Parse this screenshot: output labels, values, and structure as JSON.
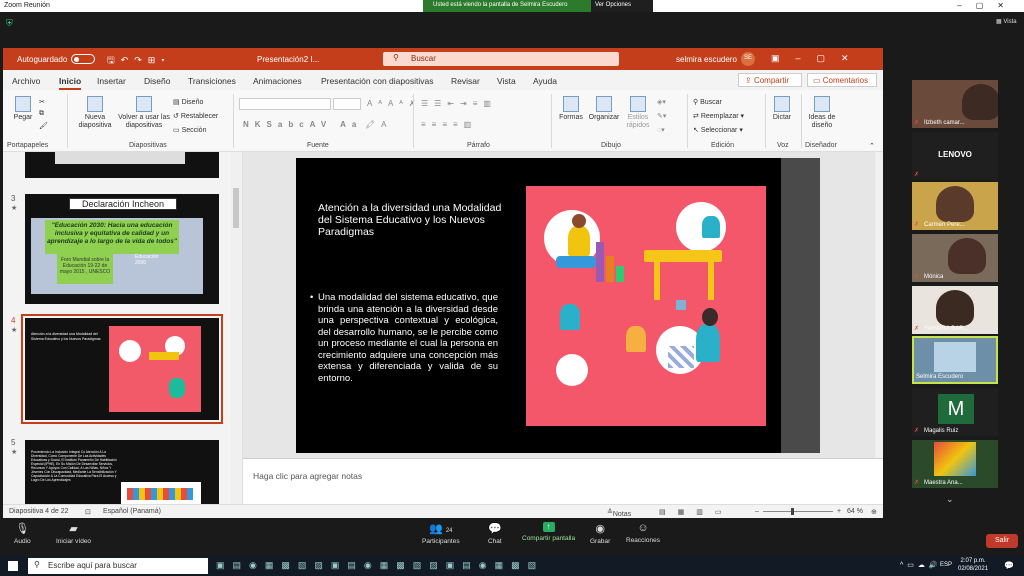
{
  "zoom": {
    "window_title": "Zoom Reunión",
    "sharing_banner": "Usted está viendo la pantalla de Selmira Escudero",
    "view_options": "Ver Opciones",
    "view_label": "Vista",
    "toolbar": {
      "audio": "Audio",
      "video": "Iniciar vídeo",
      "participants": "Participantes",
      "participants_count": "24",
      "chat": "Chat",
      "share": "Compartir pantalla",
      "record": "Grabar",
      "reactions": "Reacciones",
      "leave": "Salir"
    },
    "participants": [
      {
        "name": "Ilzbeth camar...",
        "type": "video"
      },
      {
        "name": "LENOVO",
        "type": "text"
      },
      {
        "name": "Carmen Pere...",
        "type": "video"
      },
      {
        "name": "Mónica",
        "type": "video"
      },
      {
        "name": "YAHAIRA BAR...",
        "type": "video"
      },
      {
        "name": "Selmira Escudero",
        "type": "video",
        "active": true
      },
      {
        "name": "Magalis Ruiz",
        "type": "letter",
        "letter": "M"
      },
      {
        "name": "Maestra Ana...",
        "type": "video"
      }
    ]
  },
  "ppt": {
    "autosave": "Autoguardado",
    "doc_name": "Presentación2 I...",
    "search_placeholder": "Buscar",
    "user_name": "selmira escudero",
    "user_initials": "SE",
    "tabs": [
      "Archivo",
      "Inicio",
      "Insertar",
      "Diseño",
      "Transiciones",
      "Animaciones",
      "Presentación con diapositivas",
      "Revisar",
      "Vista",
      "Ayuda"
    ],
    "active_tab": "Inicio",
    "share_btn": "Compartir",
    "comments_btn": "Comentarios",
    "ribbon": {
      "paste": "Pegar",
      "new_slide": "Nueva diapositiva",
      "reuse": "Volver a usar las diapositivas",
      "design": "Diseño",
      "reset": "Restablecer",
      "section": "Sección",
      "shapes": "Formas",
      "arrange": "Organizar",
      "quick_styles": "Estilos rápidos",
      "find": "Buscar",
      "replace": "Reemplazar",
      "select": "Seleccionar",
      "dictate": "Dictar",
      "designer": "Ideas de diseño",
      "groups": {
        "clipboard": "Portapapeles",
        "slides": "Diapositivas",
        "font": "Fuente",
        "paragraph": "Párrafo",
        "drawing": "Dibujo",
        "editing": "Edición",
        "voice": "Voz",
        "designer": "Diseñador"
      }
    },
    "thumbnails": {
      "slide3": {
        "num": "3",
        "title": "Declaración Incheon",
        "quote": "\"Educación 2030: Hacia una educación inclusiva y equitativa de calidad y un aprendizaje a lo largo de la vida de todos\"",
        "forum": "Foro Mundial sobre la Educación 19-22 de mayo 2015 , UNESCO",
        "logo": "Educación 2030"
      },
      "slide4": {
        "num": "4",
        "text": "Atención a la diversidad una Modalidad del Sistema Educativo y los Nuevos Paradigmas"
      },
      "slide5": {
        "num": "5",
        "text": "Proveniendo La Inclusión Integral Co Atención A La Diversidad, Como Componente De Las Actividades Educativas y Social, El Instituto Panameño De Habilitación Especial (IPHE), En Su Misión De Desarrollar Servicios, Recursos Y Apoyos Con Calidad, A Las Niñas, Niños Y Jóvenes Con Discapacidad, Mediante La Sensibilización Y Capacitación A La Comunidad Educativa Para El Acceso y Logro De Los Aprendizajes"
      }
    },
    "slide": {
      "title": "Atención a la diversidad una Modalidad del Sistema Educativo y los Nuevos Paradigmas",
      "bullet": "•",
      "body": "Una modalidad del sistema educativo, que brinda una atención a la diversidad desde una perspectiva contextual y ecológica, del desarrollo humano, se le percibe como un proceso mediante el cual la persona en crecimiento adquiere una concepción más extensa y diferenciada y valida de su entorno."
    },
    "notes_placeholder": "Haga clic para agregar notas",
    "status": {
      "slide_info": "Diapositiva 4 de 22",
      "language": "Español (Panamá)",
      "notes": "Notas",
      "zoom": "64 %"
    }
  },
  "taskbar": {
    "search_placeholder": "Escribe aquí para buscar",
    "lang": "ESP",
    "time": "2:07 p.m.",
    "date": "02/08/2021"
  },
  "colors": {
    "ppt_accent": "#c43e1c",
    "zoom_green": "#2c7a2c",
    "slide_image_bg": "#f4576a"
  }
}
